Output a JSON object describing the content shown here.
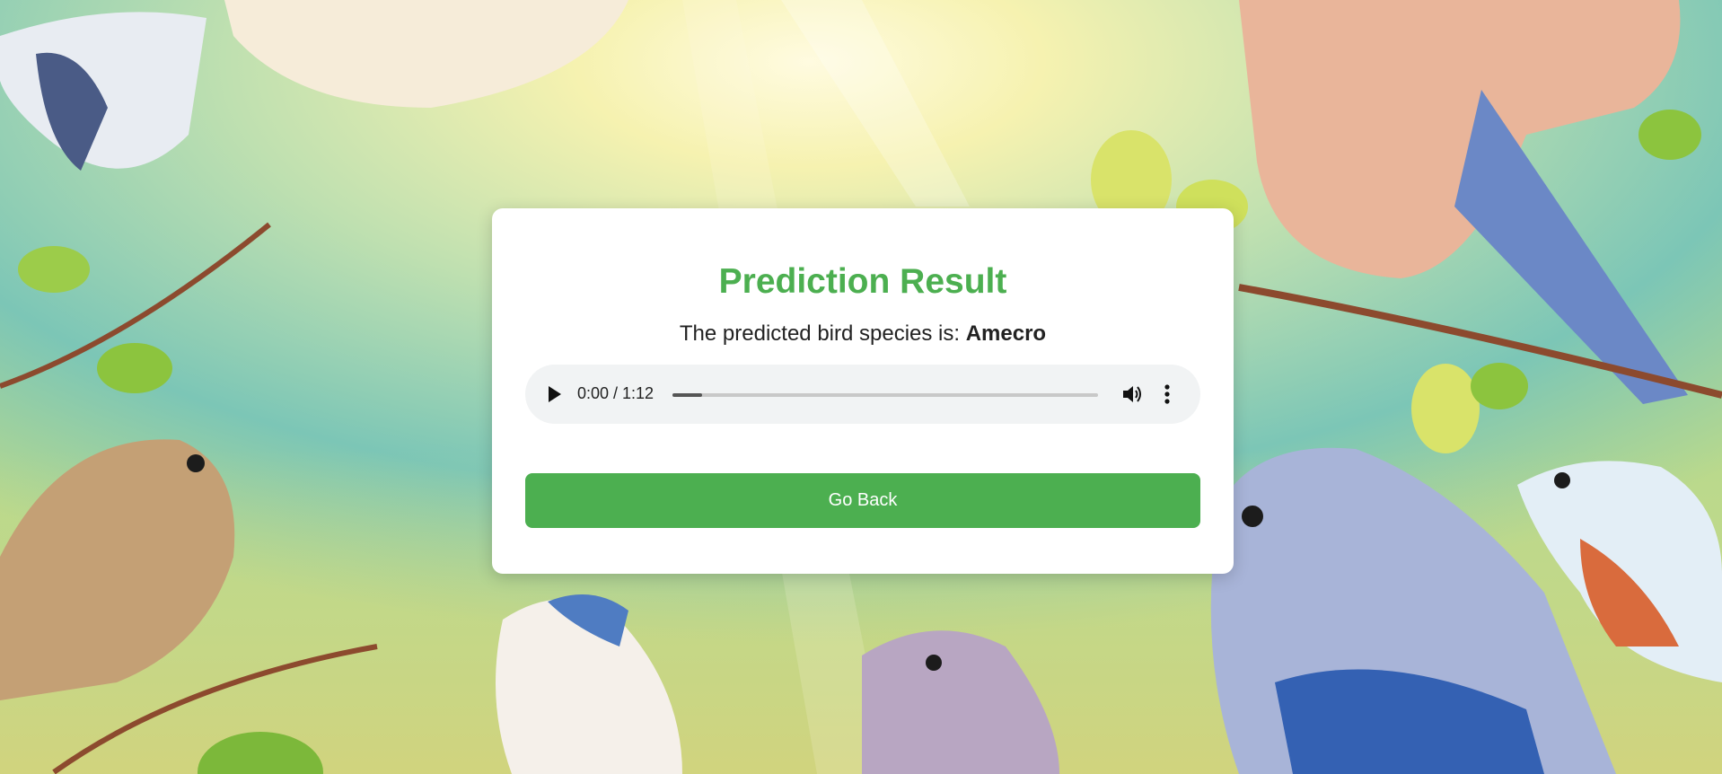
{
  "page": {
    "title": "Prediction Result",
    "result_prefix": "The predicted bird species is: ",
    "species": "Amecro"
  },
  "audio": {
    "time_display": "0:00 / 1:12",
    "progress_fraction": 0.07,
    "play_icon": "play-icon",
    "volume_icon": "volume-icon",
    "more_icon": "more-options-icon"
  },
  "actions": {
    "back_label": "Go Back"
  },
  "colors": {
    "accent": "#4caf50",
    "card_bg": "#ffffff",
    "audio_bg": "#f1f3f4"
  }
}
